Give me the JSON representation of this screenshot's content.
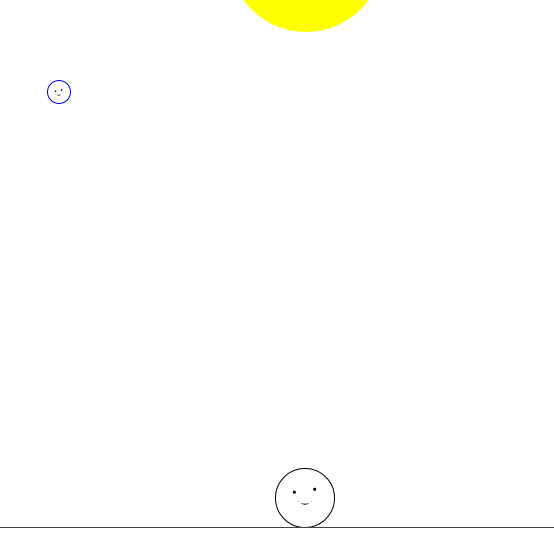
{
  "scene": {
    "background_color": "#ffffff",
    "sun": {
      "icon": "sun-circle",
      "color": "#ffff00"
    },
    "enemy": {
      "icon": "small-smiley-face",
      "outline_color": "#0000ee",
      "face_color": "#000000"
    },
    "player": {
      "icon": "smiley-face",
      "outline_color": "#000000",
      "face_color": "#000000"
    },
    "ground": {
      "color": "#444444"
    }
  }
}
